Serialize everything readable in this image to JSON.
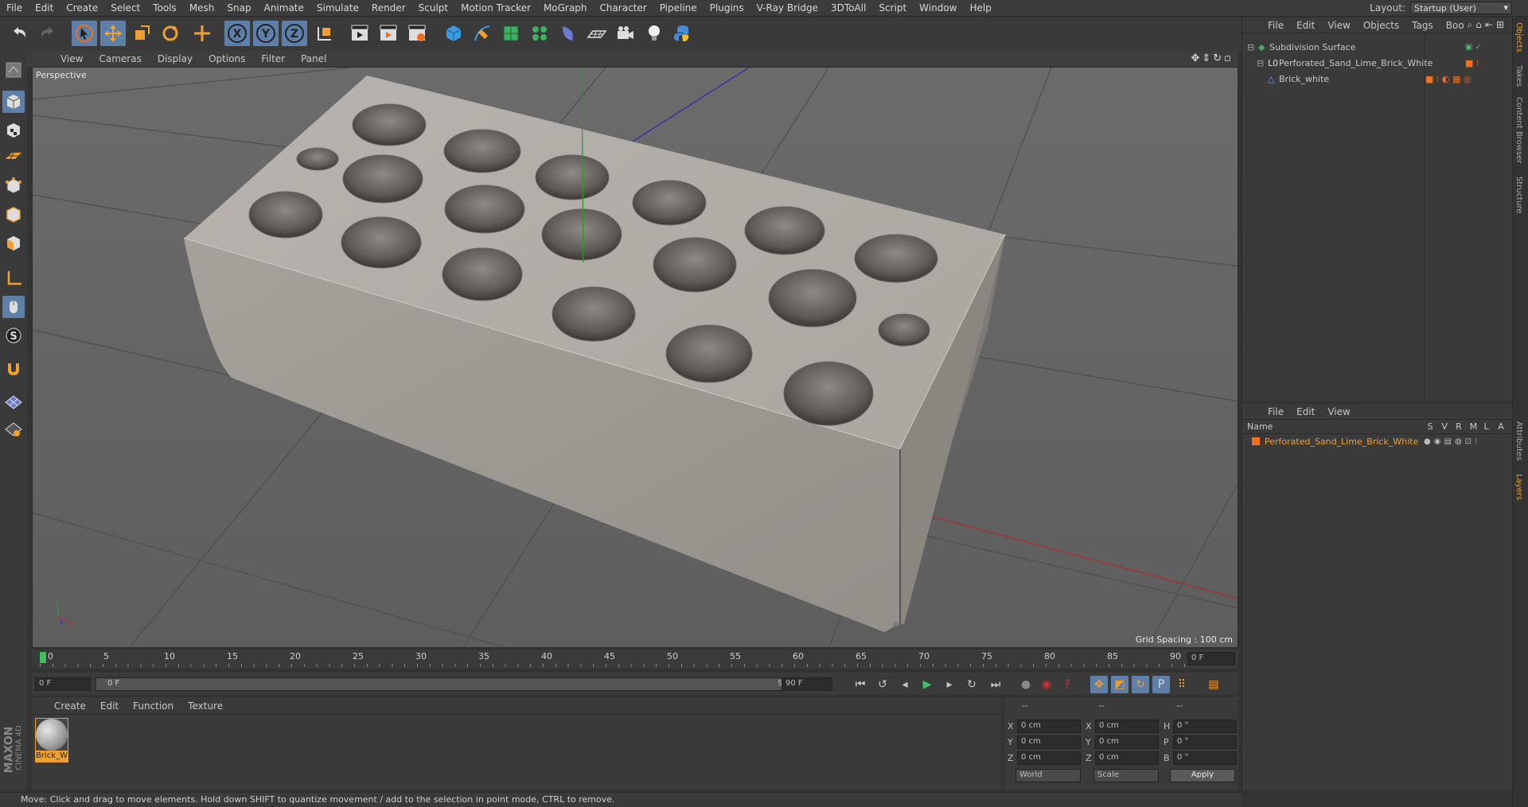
{
  "menubar": {
    "items": [
      "File",
      "Edit",
      "Create",
      "Select",
      "Tools",
      "Mesh",
      "Snap",
      "Animate",
      "Simulate",
      "Render",
      "Sculpt",
      "Motion Tracker",
      "MoGraph",
      "Character",
      "Pipeline",
      "Plugins",
      "V-Ray Bridge",
      "3DToAll",
      "Script",
      "Window",
      "Help"
    ],
    "layout_label": "Layout:",
    "layout_value": "Startup (User)"
  },
  "viewport": {
    "menu": [
      "View",
      "Cameras",
      "Display",
      "Options",
      "Filter",
      "Panel"
    ],
    "label": "Perspective",
    "grid_spacing": "Grid Spacing : 100 cm"
  },
  "timeline": {
    "ticks": [
      "0",
      "5",
      "10",
      "15",
      "20",
      "25",
      "30",
      "35",
      "40",
      "45",
      "50",
      "55",
      "60",
      "65",
      "70",
      "75",
      "80",
      "85",
      "90"
    ],
    "end_field": "0 F"
  },
  "transport": {
    "current": "0 F",
    "range_start": "0 F",
    "range_end": "90 F",
    "max": "90 F"
  },
  "material_manager": {
    "menu": [
      "Create",
      "Edit",
      "Function",
      "Texture"
    ],
    "material_name": "Brick_W"
  },
  "coordinates": {
    "header": [
      "--",
      "--",
      "--"
    ],
    "rows": [
      {
        "a": "X",
        "av": "0 cm",
        "b": "X",
        "bv": "0 cm",
        "c": "H",
        "cv": "0 °"
      },
      {
        "a": "Y",
        "av": "0 cm",
        "b": "Y",
        "bv": "0 cm",
        "c": "P",
        "cv": "0 °"
      },
      {
        "a": "Z",
        "av": "0 cm",
        "b": "Z",
        "bv": "0 cm",
        "c": "B",
        "cv": "0 °"
      }
    ],
    "mode": "World",
    "type": "Scale",
    "apply": "Apply"
  },
  "object_manager": {
    "menu": [
      "File",
      "Edit",
      "View",
      "Objects",
      "Tags",
      "Boo"
    ],
    "objects": [
      {
        "name": "Subdivision Surface",
        "color": "#cccccc"
      },
      {
        "name": "Perforated_Sand_Lime_Brick_White",
        "color": "#cccccc"
      },
      {
        "name": "Brick_white",
        "color": "#cccccc"
      }
    ]
  },
  "layer_manager": {
    "menu": [
      "File",
      "Edit",
      "View"
    ],
    "columns": [
      "Name",
      "S",
      "V",
      "R",
      "M",
      "L",
      "A"
    ],
    "layers": [
      {
        "name": "Perforated_Sand_Lime_Brick_White",
        "color": "#f0a030"
      }
    ]
  },
  "side_tabs": [
    "Objects",
    "Takes",
    "Content Browser",
    "Structure"
  ],
  "side_tabs_lower": [
    "Attributes",
    "Layers"
  ],
  "status": "Move: Click and drag to move elements. Hold down SHIFT to quantize movement / add to the selection in point mode, CTRL to remove.",
  "brand": {
    "line1": "MAXON",
    "line2": "CINEMA 4D"
  },
  "colors": {
    "accent": "#f0a030",
    "selection": "#5d7fa8",
    "axis_x": "#c03030",
    "axis_y": "#30a030",
    "axis_z": "#3030c0"
  }
}
